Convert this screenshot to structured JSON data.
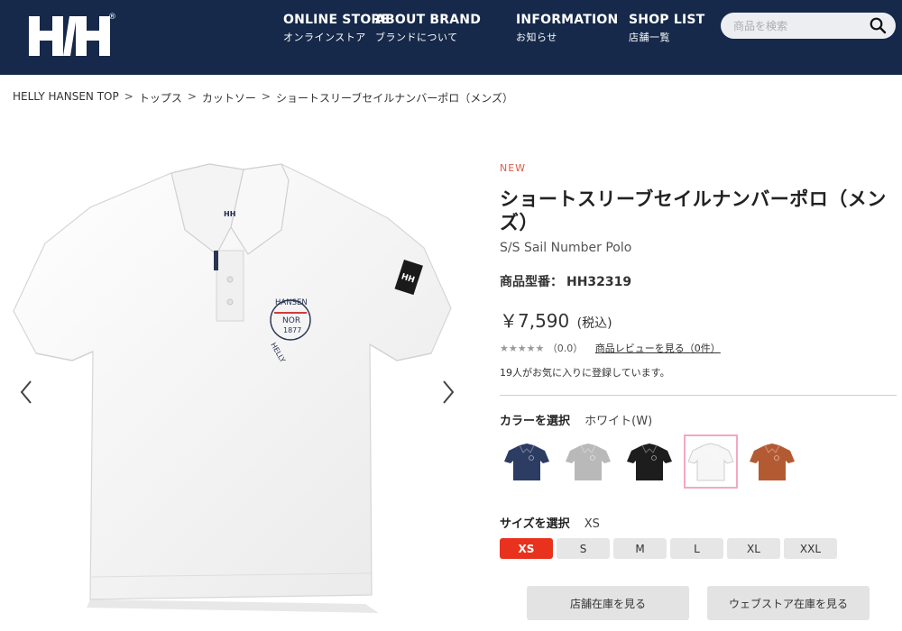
{
  "brand": {
    "logo_text": "HH",
    "trademark": "®"
  },
  "nav": [
    {
      "en": "ONLINE STORE",
      "jp": "オンラインストア"
    },
    {
      "en": "ABOUT BRAND",
      "jp": "ブランドについて"
    },
    {
      "en": "INFORMATION",
      "jp": "お知らせ"
    },
    {
      "en": "SHOP LIST",
      "jp": "店舗一覧"
    }
  ],
  "search": {
    "placeholder": "商品を検索",
    "icon": "search-icon"
  },
  "breadcrumb": [
    "HELLY HANSEN TOP",
    "トップス",
    "カットソー",
    "ショートスリーブセイルナンバーポロ（メンズ）"
  ],
  "breadcrumb_sep": ">",
  "product": {
    "badge": "NEW",
    "title_jp": "ショートスリーブセイルナンバーポロ（メンズ）",
    "title_en": "S/S Sail Number Polo",
    "model_label": "商品型番：",
    "model_value": "HH32319",
    "price": "￥7,590",
    "price_tax": "(税込)",
    "stars": "★★★★★",
    "rating": "（0.0）",
    "review_link": "商品レビューを見る（0件）",
    "favorites": "19人がお気に入りに登録しています。",
    "emblem": {
      "top": "HANSEN",
      "mid": "NOR",
      "year": "1877",
      "side": "HELLY"
    },
    "sleeve_logo": "HH"
  },
  "color": {
    "label": "カラーを選択",
    "selected": "ホワイト(W)",
    "swatches": [
      {
        "name": "navy",
        "color": "#2c3c62"
      },
      {
        "name": "gray",
        "color": "#b9b9b9"
      },
      {
        "name": "black",
        "color": "#1d1d1d"
      },
      {
        "name": "white",
        "color": "#f6f6f6",
        "selected": true
      },
      {
        "name": "orange",
        "color": "#b45a32"
      }
    ]
  },
  "size": {
    "label": "サイズを選択",
    "selected": "XS",
    "options": [
      "XS",
      "S",
      "M",
      "L",
      "XL",
      "XXL"
    ]
  },
  "actions": {
    "store_stock": "店舗在庫を見る",
    "web_stock": "ウェブストア在庫を見る"
  },
  "colors": {
    "header_bg": "#16294a",
    "accent_red": "#e8321e",
    "new_badge": "#e05a4a",
    "selected_swatch_border": "#f2a8c4"
  }
}
